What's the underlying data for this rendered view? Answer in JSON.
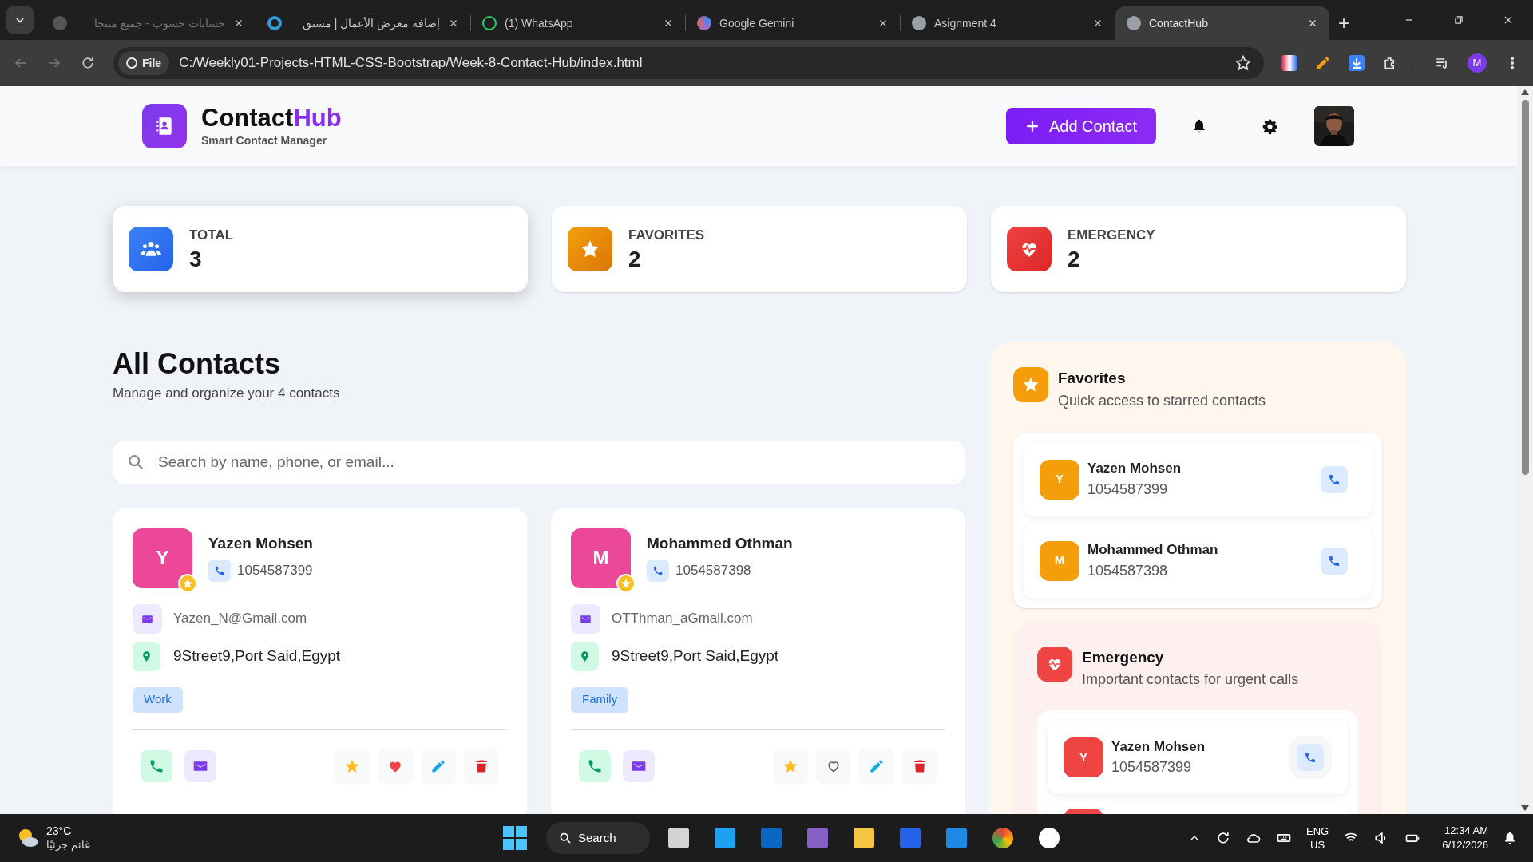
{
  "browser": {
    "tabs": [
      {
        "title": "حسابات حسوب - جميع منتجا",
        "selected": false,
        "faded": true
      },
      {
        "title": "إضافة معرض الأعمال | مستق",
        "selected": false,
        "faded": false
      },
      {
        "title": "(1) WhatsApp",
        "selected": false,
        "faded": false
      },
      {
        "title": "Google Gemini",
        "selected": false,
        "faded": false
      },
      {
        "title": "Asignment 4",
        "selected": false,
        "faded": false
      },
      {
        "title": "ContactHub",
        "selected": true,
        "faded": false
      }
    ],
    "new_tab": "+",
    "scheme_chip": "File",
    "address": "C:/Weekly01-Projects-HTML-CSS-Bootstrap/Week-8-Contact-Hub/index.html",
    "profile_initial": "M"
  },
  "header": {
    "brand_main": "Contact",
    "brand_accent": "Hub",
    "tagline": "Smart Contact Manager",
    "add_button": "Add Contact"
  },
  "stats": [
    {
      "kind": "total",
      "label": "TOTAL",
      "value": "3",
      "raised": true
    },
    {
      "kind": "favorites",
      "label": "FAVORITES",
      "value": "2",
      "raised": false
    },
    {
      "kind": "emergency",
      "label": "EMERGENCY",
      "value": "2",
      "raised": false
    }
  ],
  "contacts_section": {
    "title": "All Contacts",
    "subtitle": "Manage and organize your 4 contacts",
    "search": {
      "placeholder": "Search by name, phone, or email..."
    }
  },
  "contacts": [
    {
      "initial": "Y",
      "name": "Yazen Mohsen",
      "phone": "1054587399",
      "email": "Yazen_N@Gmail.com",
      "address": "9Street9,Port Said,Egypt",
      "tag": "Work",
      "favorite": true,
      "emergency": true
    },
    {
      "initial": "M",
      "name": "Mohammed Othman",
      "phone": "1054587398",
      "email": "OTThman_aGmail.com",
      "address": "9Street9,Port Said,Egypt",
      "tag": "Family",
      "favorite": true,
      "emergency": false
    }
  ],
  "favorites_panel": {
    "title": "Favorites",
    "subtitle": "Quick access to starred contacts",
    "items": [
      {
        "initial": "Y",
        "name": "Yazen Mohsen",
        "phone": "1054587399"
      },
      {
        "initial": "M",
        "name": "Mohammed Othman",
        "phone": "1054587398"
      }
    ]
  },
  "emergency_panel": {
    "title": "Emergency",
    "subtitle": "Important contacts for urgent calls",
    "items": [
      {
        "initial": "Y",
        "name": "Yazen Mohsen",
        "phone": "1054587399"
      }
    ]
  },
  "taskbar": {
    "temperature": "23°C",
    "weather": "غائم جزئيًا",
    "search": "Search",
    "language": "ENG",
    "region": "US",
    "time": "12:34 AM",
    "date": "6/12/2026"
  }
}
